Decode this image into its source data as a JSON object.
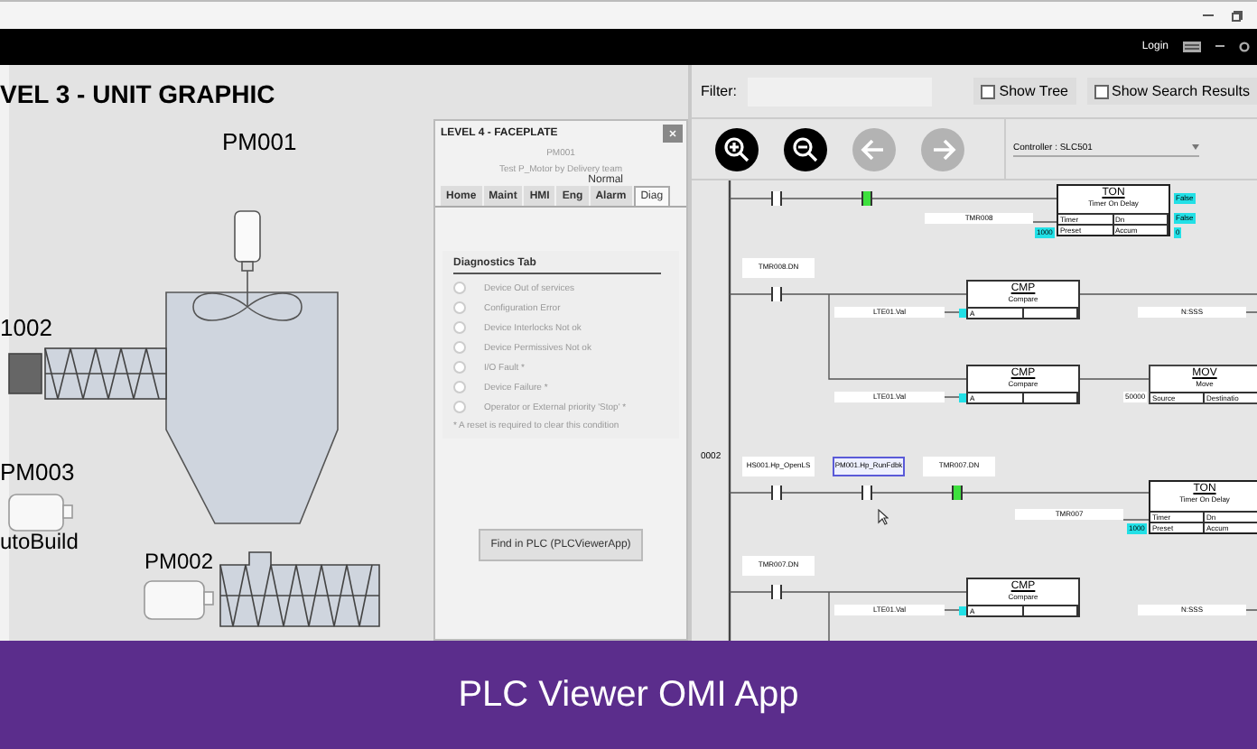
{
  "app_bar": {
    "login": "Login"
  },
  "unit_graphic": {
    "title": "VEL 3 - UNIT GRAPHIC",
    "labels": [
      "PM001",
      "1002",
      "PM003",
      "utoBuild",
      "PM002"
    ]
  },
  "faceplate": {
    "title": "LEVEL 4 - FACEPLATE",
    "device": "PM001",
    "description": "Test P_Motor by Delivery team",
    "status": "Normal",
    "tabs": [
      {
        "label": "Home",
        "selected": false
      },
      {
        "label": "Maint",
        "selected": false
      },
      {
        "label": "HMI",
        "selected": false
      },
      {
        "label": "Eng",
        "selected": false
      },
      {
        "label": "Alarm",
        "selected": false
      },
      {
        "label": "Diag",
        "selected": true
      }
    ],
    "section_title": "Diagnostics Tab",
    "diagnostics": [
      {
        "label": "Device Out of services",
        "active": false
      },
      {
        "label": "Configuration Error",
        "active": false
      },
      {
        "label": "Device Interlocks Not ok",
        "active": false
      },
      {
        "label": "Device Permissives Not ok",
        "active": false
      },
      {
        "label": "I/O Fault *",
        "active": false
      },
      {
        "label": "Device Failure  *",
        "active": false
      },
      {
        "label": "Operator or External priority 'Stop' *",
        "active": false
      }
    ],
    "note": "* A reset is required to clear this condition",
    "button": "Find in PLC (PLCViewerApp)"
  },
  "plc_viewer": {
    "filter_label": "Filter:",
    "show_tree": {
      "label": "Show Tree",
      "checked": false
    },
    "show_search_results": {
      "label": "Show Search Results",
      "checked": false
    },
    "toolbar": [
      {
        "kind": "zoom-in",
        "disabled": false
      },
      {
        "kind": "zoom-out",
        "disabled": false
      },
      {
        "kind": "back",
        "disabled": true
      },
      {
        "kind": "forward",
        "disabled": true
      }
    ],
    "controller": {
      "label": "Controller :",
      "value": "SLC501"
    },
    "ladder": {
      "rung_number": "0002",
      "contacts": [
        {
          "energized": false
        },
        {
          "energized": true
        },
        {
          "tag": "TMR008.DN",
          "energized": false,
          "selected": false
        },
        {
          "tag": "HS001.Hp_OpenLS",
          "energized": false,
          "selected": false
        },
        {
          "tag": "PM001.Hp_RunFdbk",
          "energized": false,
          "selected": true
        },
        {
          "tag": "TMR007.DN",
          "energized": true,
          "selected": false
        },
        {
          "tag": "TMR007.DN",
          "energized": false,
          "selected": false
        }
      ],
      "blocks": [
        {
          "kind": "ton",
          "name": "TON",
          "description": "Timer On Delay",
          "cells": [
            "Timer",
            "Dn",
            "Preset",
            "Accum"
          ]
        },
        {
          "kind": "cmp",
          "name": "CMP",
          "description": "Compare",
          "cells": [
            "A"
          ]
        },
        {
          "kind": "cmp",
          "name": "CMP",
          "description": "Compare",
          "cells": [
            "A"
          ]
        },
        {
          "kind": "mov",
          "name": "MOV",
          "description": "Move",
          "cells": [
            "Source",
            "Destinatio"
          ]
        },
        {
          "kind": "ton",
          "name": "TON",
          "description": "Timer On Delay",
          "cells": [
            "Timer",
            "Dn",
            "Preset",
            "Accum"
          ]
        },
        {
          "kind": "cmp",
          "name": "CMP",
          "description": "Compare",
          "cells": [
            "A"
          ]
        }
      ],
      "operands": [
        "TMR008",
        "LTE01.Val",
        "N:SSS",
        "LTE01.Val",
        "TMR007",
        "LTE01.Val",
        "N:SSS"
      ],
      "values": [
        {
          "text": "False",
          "kind": "live"
        },
        {
          "text": "False",
          "kind": "live"
        },
        {
          "text": "0",
          "kind": "live"
        },
        {
          "text": "1000",
          "kind": "live"
        },
        {
          "text": "50000",
          "kind": "constant"
        },
        {
          "text": "1000",
          "kind": "live"
        }
      ]
    }
  },
  "banner": {
    "text": "PLC Viewer OMI App"
  }
}
